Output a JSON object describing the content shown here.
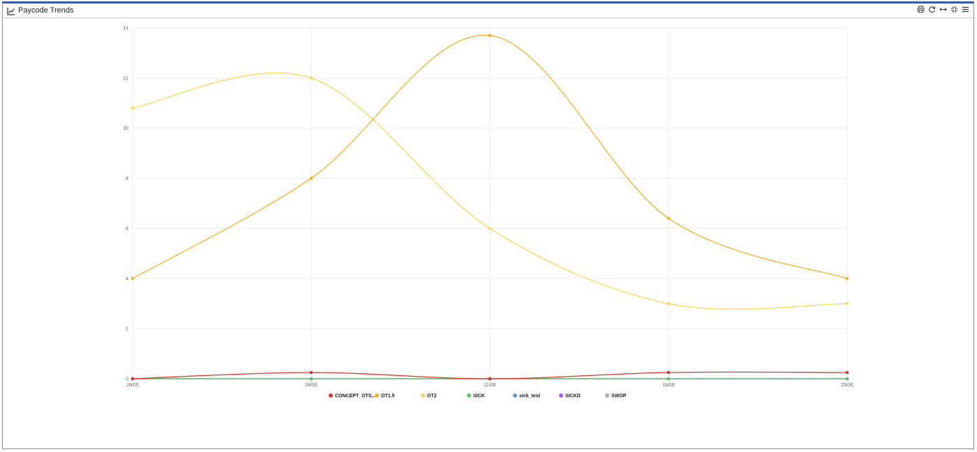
{
  "window": {
    "title": "Paycode Trends"
  },
  "toolbar": {
    "icons": [
      "print-icon",
      "refresh-icon",
      "expand-horizontal-icon",
      "collapse-icon",
      "menu-icon"
    ]
  },
  "chart_data": {
    "type": "line",
    "curve": "smooth",
    "title": "",
    "xlabel": "",
    "ylabel": "",
    "x": [
      "28/05",
      "04/06",
      "11/06",
      "18/06",
      "25/06"
    ],
    "ylim": [
      0,
      14
    ],
    "yticks": [
      0,
      2,
      4,
      6,
      8,
      10,
      12,
      14
    ],
    "grid": true,
    "legend_position": "bottom",
    "series": [
      {
        "name": "CONCEPT_OTS...",
        "color": "#d9342b",
        "values": [
          0,
          0.25,
          0,
          0.25,
          0.25
        ]
      },
      {
        "name": "OT1.5",
        "color": "#f0b429",
        "values": [
          4,
          8,
          13.7,
          6.4,
          4
        ]
      },
      {
        "name": "OT2",
        "color": "#f9d85a",
        "values": [
          10.8,
          12,
          6,
          3,
          3
        ]
      },
      {
        "name": "SICK",
        "color": "#5cc85a",
        "values": [
          0,
          0,
          0,
          0,
          0
        ]
      },
      {
        "name": "sick_test",
        "color": "#5b9bd5",
        "values": [
          0,
          0,
          0,
          0,
          0
        ]
      },
      {
        "name": "SICKD",
        "color": "#a35ad6",
        "values": [
          0,
          0,
          0,
          0,
          0
        ]
      },
      {
        "name": "SWOP",
        "color": "#aaaaaa",
        "values": [
          0,
          0,
          0,
          0,
          0
        ]
      }
    ]
  }
}
